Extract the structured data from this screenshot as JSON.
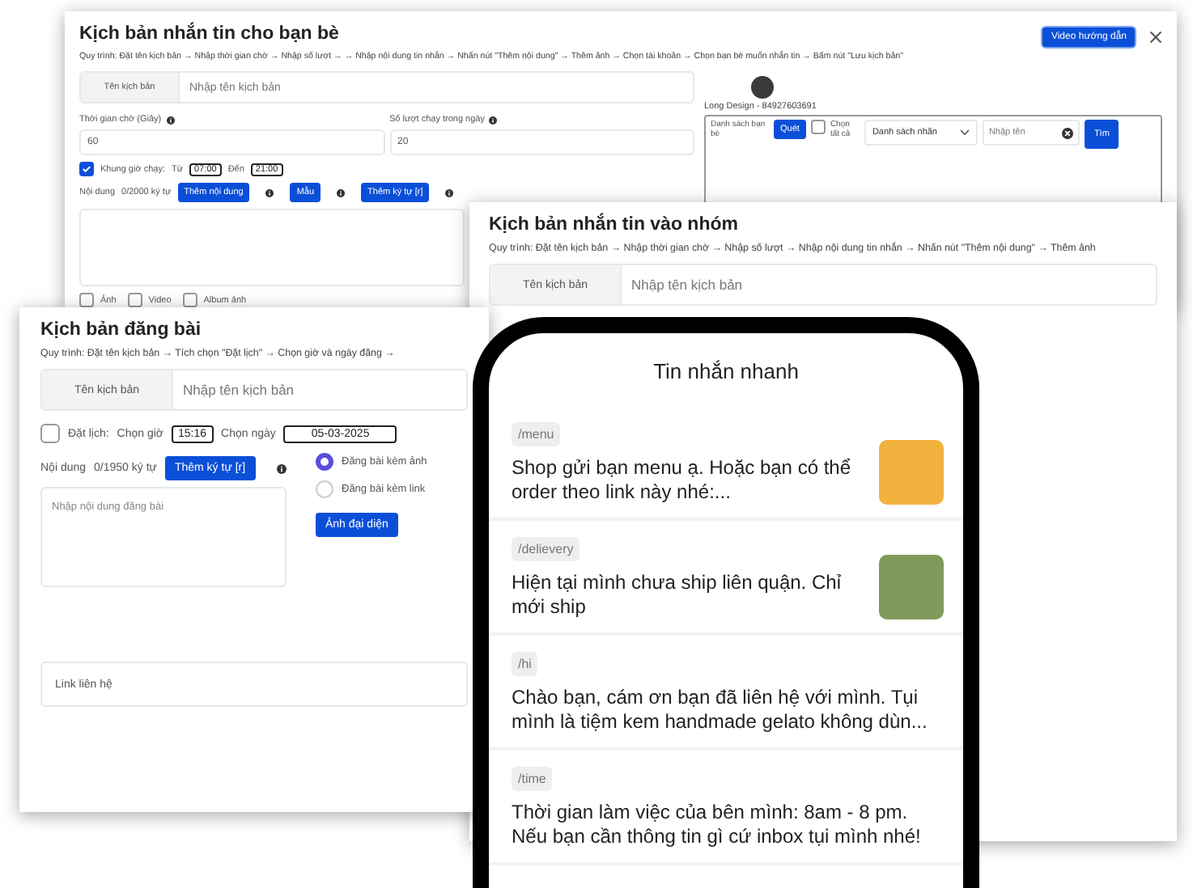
{
  "friend_script_window": {
    "title": "Kịch bản nhắn tin cho bạn bè",
    "guide_button": "Video hướng dẫn",
    "process": "Quy trình: Đặt tên kịch bản → Nhập thời gian chờ → Nhập số lượt → → Nhập nội dung tin nhắn → Nhấn nút \"Thêm nội dung\" → Thêm ảnh → Chọn tài khoản → Chọn bạn bè muốn nhắn tin → Bấm nút \"Lưu kịch bản\"",
    "name_field": {
      "label": "Tên kịch bản",
      "placeholder": "Nhập tên kịch bản"
    },
    "wait_field": {
      "label": "Thời gian chờ (Giây)",
      "value": "60"
    },
    "runs_field": {
      "label": "Số lượt chạy trong ngày",
      "value": "20"
    },
    "time_window": {
      "checked": true,
      "label": "Khung giờ chạy:",
      "from_label": "Từ",
      "from": "07:00",
      "to_label": "Đến",
      "to": "21:00"
    },
    "content": {
      "label": "Nội dung",
      "counter": "0/2000 ký tự",
      "buttons": [
        "Thêm nội dung",
        "Mẫu",
        "Thêm ký tự [r]"
      ]
    },
    "attachments": [
      {
        "label": "Ảnh",
        "checked": false
      },
      {
        "label": "Video",
        "checked": false
      },
      {
        "label": "Album ảnh",
        "checked": false
      }
    ],
    "account": "Long Design - 84927603691",
    "friends_panel": {
      "label": "Danh sách bạn bè",
      "scan_button": "Quét",
      "select_all": {
        "label": "Chọn tất cả",
        "checked": false
      },
      "tag_select": "Danh sách nhãn",
      "search_placeholder": "Nhập tên",
      "search_button": "Tìm"
    }
  },
  "group_script_window": {
    "title": "Kịch bản nhắn tin vào nhóm",
    "process": "Quy trình: Đặt tên kịch bản → Nhập thời gian chờ → Nhập số lượt → Nhập nội dung tin nhắn → Nhấn nút \"Thêm nội dung\" → Thêm ảnh",
    "name_field": {
      "label": "Tên kịch bản",
      "placeholder": "Nhập tên kịch bản"
    }
  },
  "post_script_window": {
    "title": "Kịch bản đăng bài",
    "process": "Quy trình: Đặt tên kịch bản → Tích chọn \"Đặt lịch\" → Chọn giờ và ngày đăng →",
    "name_field": {
      "label": "Tên kịch bản",
      "placeholder": "Nhập tên kịch bản"
    },
    "schedule": {
      "checked": false,
      "label": "Đặt lịch:",
      "time_label": "Chọn giờ",
      "time": "15:16",
      "date_label": "Chọn ngày",
      "date": "05-03-2025"
    },
    "content": {
      "label": "Nội dung",
      "counter": "0/1950 ký tự",
      "button": "Thêm ký tự [r]",
      "placeholder": "Nhập nội dung đăng bài"
    },
    "post_types": [
      {
        "label": "Đăng bài kèm ảnh",
        "selected": true
      },
      {
        "label": "Đăng bài kèm link",
        "selected": false
      }
    ],
    "avatar_button": "Ảnh đại diện",
    "link_field": {
      "placeholder": "Link liên hệ"
    }
  },
  "quick_messages": {
    "title": "Tin nhắn nhanh",
    "items": [
      {
        "kind": "with_photo",
        "shortcut": "/menu",
        "text": "Shop gửi bạn menu ạ. Hoặc bạn có thể order theo link này nhé:..."
      },
      {
        "kind": "with_photo",
        "shortcut": "/delievery",
        "text": "Hiện tại mình chưa ship liên quận. Chỉ mới ship"
      },
      {
        "kind": "text_only",
        "shortcut": "/hi",
        "text": "Chào bạn, cám ơn bạn đã liên hệ với mình. Tụi mình là tiệm kem handmade gelato không dùn..."
      },
      {
        "kind": "text_only",
        "shortcut": "/time",
        "text": "Thời gian làm việc của bên mình: 8am - 8 pm. Nếu bạn cần thông tin gì cứ inbox tụi mình nhé!"
      }
    ]
  }
}
